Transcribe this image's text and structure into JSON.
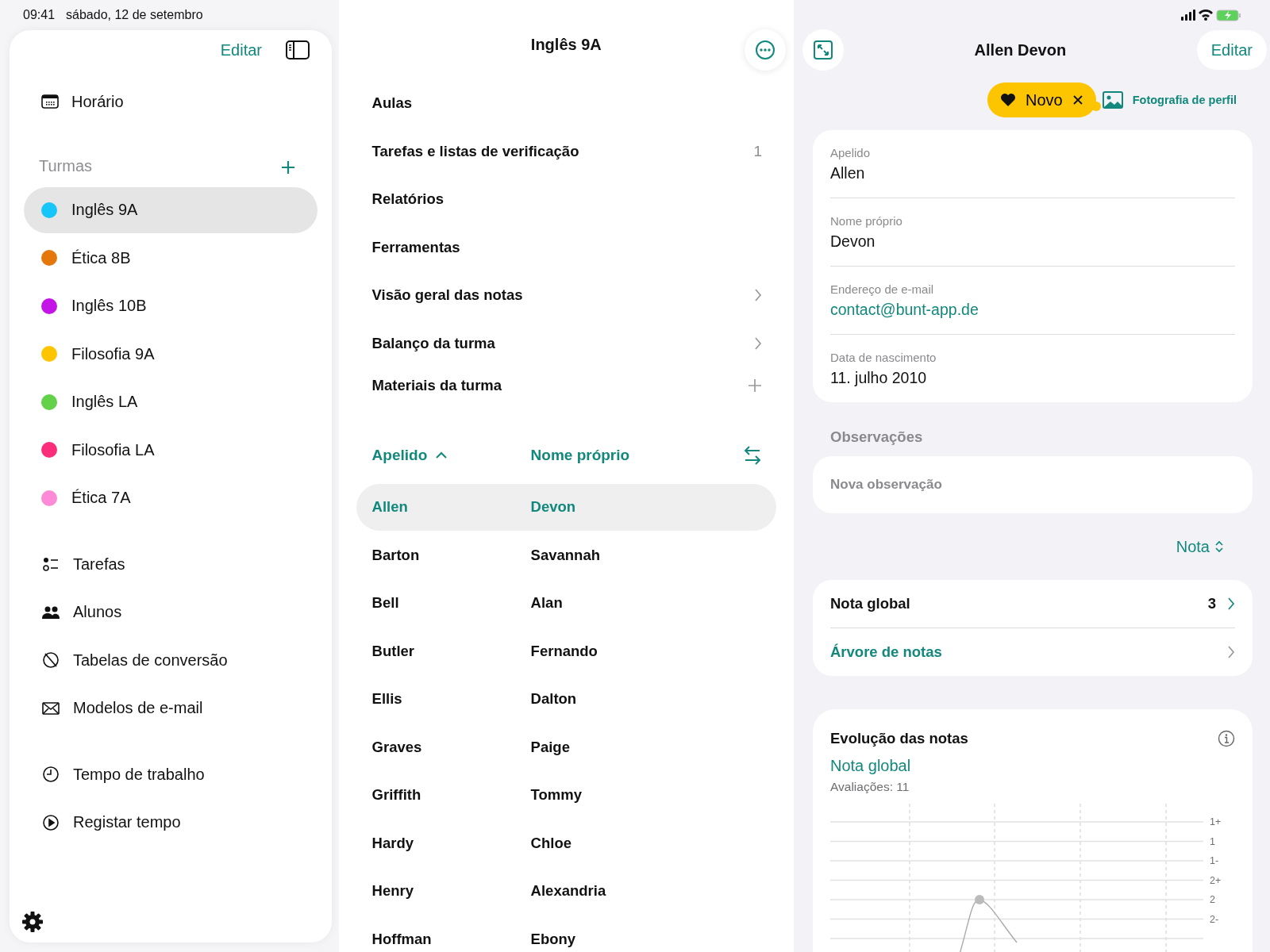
{
  "status_bar": {
    "time": "09:41",
    "date": "sábado, 12 de setembro"
  },
  "sidebar": {
    "edit": "Editar",
    "top_items": [
      {
        "label": "Horário"
      }
    ],
    "classes_title": "Turmas",
    "classes": [
      {
        "label": "Inglês 9A",
        "color": "#16c6f8",
        "selected": true
      },
      {
        "label": "Ética 8B",
        "color": "#e5780c",
        "selected": false
      },
      {
        "label": "Inglês 10B",
        "color": "#c316e6",
        "selected": false
      },
      {
        "label": "Filosofia 9A",
        "color": "#fcc500",
        "selected": false
      },
      {
        "label": "Inglês LA",
        "color": "#63d14a",
        "selected": false
      },
      {
        "label": "Filosofia LA",
        "color": "#fc2e7c",
        "selected": false
      },
      {
        "label": "Ética 7A",
        "color": "#fd8ad6",
        "selected": false
      }
    ],
    "items": [
      {
        "label": "Tarefas"
      },
      {
        "label": "Alunos"
      },
      {
        "label": "Tabelas de conversão"
      },
      {
        "label": "Modelos de e-mail"
      }
    ],
    "bottom_items": [
      {
        "label": "Tempo de trabalho"
      },
      {
        "label": "Registar tempo"
      }
    ]
  },
  "class_view": {
    "title": "Inglês 9A",
    "menu": [
      {
        "label": "Aulas",
        "kind": "plain"
      },
      {
        "label": "Tarefas e listas de verificação",
        "kind": "count",
        "count": "1"
      },
      {
        "label": "Relatórios",
        "kind": "plain"
      },
      {
        "label": "Ferramentas",
        "kind": "plain"
      },
      {
        "label": "Visão geral das notas",
        "kind": "chevron"
      },
      {
        "label": "Balanço da turma",
        "kind": "chevron"
      },
      {
        "label": "Materiais da turma",
        "kind": "add"
      }
    ],
    "columns": [
      "Apelido",
      "Nome próprio"
    ],
    "students": [
      {
        "last": "Allen",
        "first": "Devon",
        "selected": true
      },
      {
        "last": "Barton",
        "first": "Savannah",
        "selected": false
      },
      {
        "last": "Bell",
        "first": "Alan",
        "selected": false
      },
      {
        "last": "Butler",
        "first": "Fernando",
        "selected": false
      },
      {
        "last": "Ellis",
        "first": "Dalton",
        "selected": false
      },
      {
        "last": "Graves",
        "first": "Paige",
        "selected": false
      },
      {
        "last": "Griffith",
        "first": "Tommy",
        "selected": false
      },
      {
        "last": "Hardy",
        "first": "Chloe",
        "selected": false
      },
      {
        "last": "Henry",
        "first": "Alexandria",
        "selected": false
      },
      {
        "last": "Hoffman",
        "first": "Ebony",
        "selected": false
      }
    ]
  },
  "student": {
    "title": "Allen Devon",
    "edit": "Editar",
    "tag": "Novo",
    "photo_link": "Fotografia de perfil",
    "fields": [
      {
        "label": "Apelido",
        "value": "Allen",
        "kind": "text"
      },
      {
        "label": "Nome próprio",
        "value": "Devon",
        "kind": "text"
      },
      {
        "label": "Endereço de e-mail",
        "value": "contact@bunt-app.de",
        "kind": "link"
      },
      {
        "label": "Data de nascimento",
        "value": "11. julho 2010",
        "kind": "text"
      }
    ],
    "notes_title": "Observações",
    "note_placeholder": "Nova observação",
    "sort": "Nota",
    "grades": [
      {
        "label": "Nota global",
        "value": "3",
        "kind": "value"
      },
      {
        "label": "Árvore de notas",
        "kind": "link"
      }
    ],
    "chart": {
      "title": "Evolução das notas",
      "series": "Nota global",
      "count": "Avaliações: 11",
      "y_labels": [
        "1+",
        "1",
        "1-",
        "2+",
        "2",
        "2-"
      ]
    }
  }
}
